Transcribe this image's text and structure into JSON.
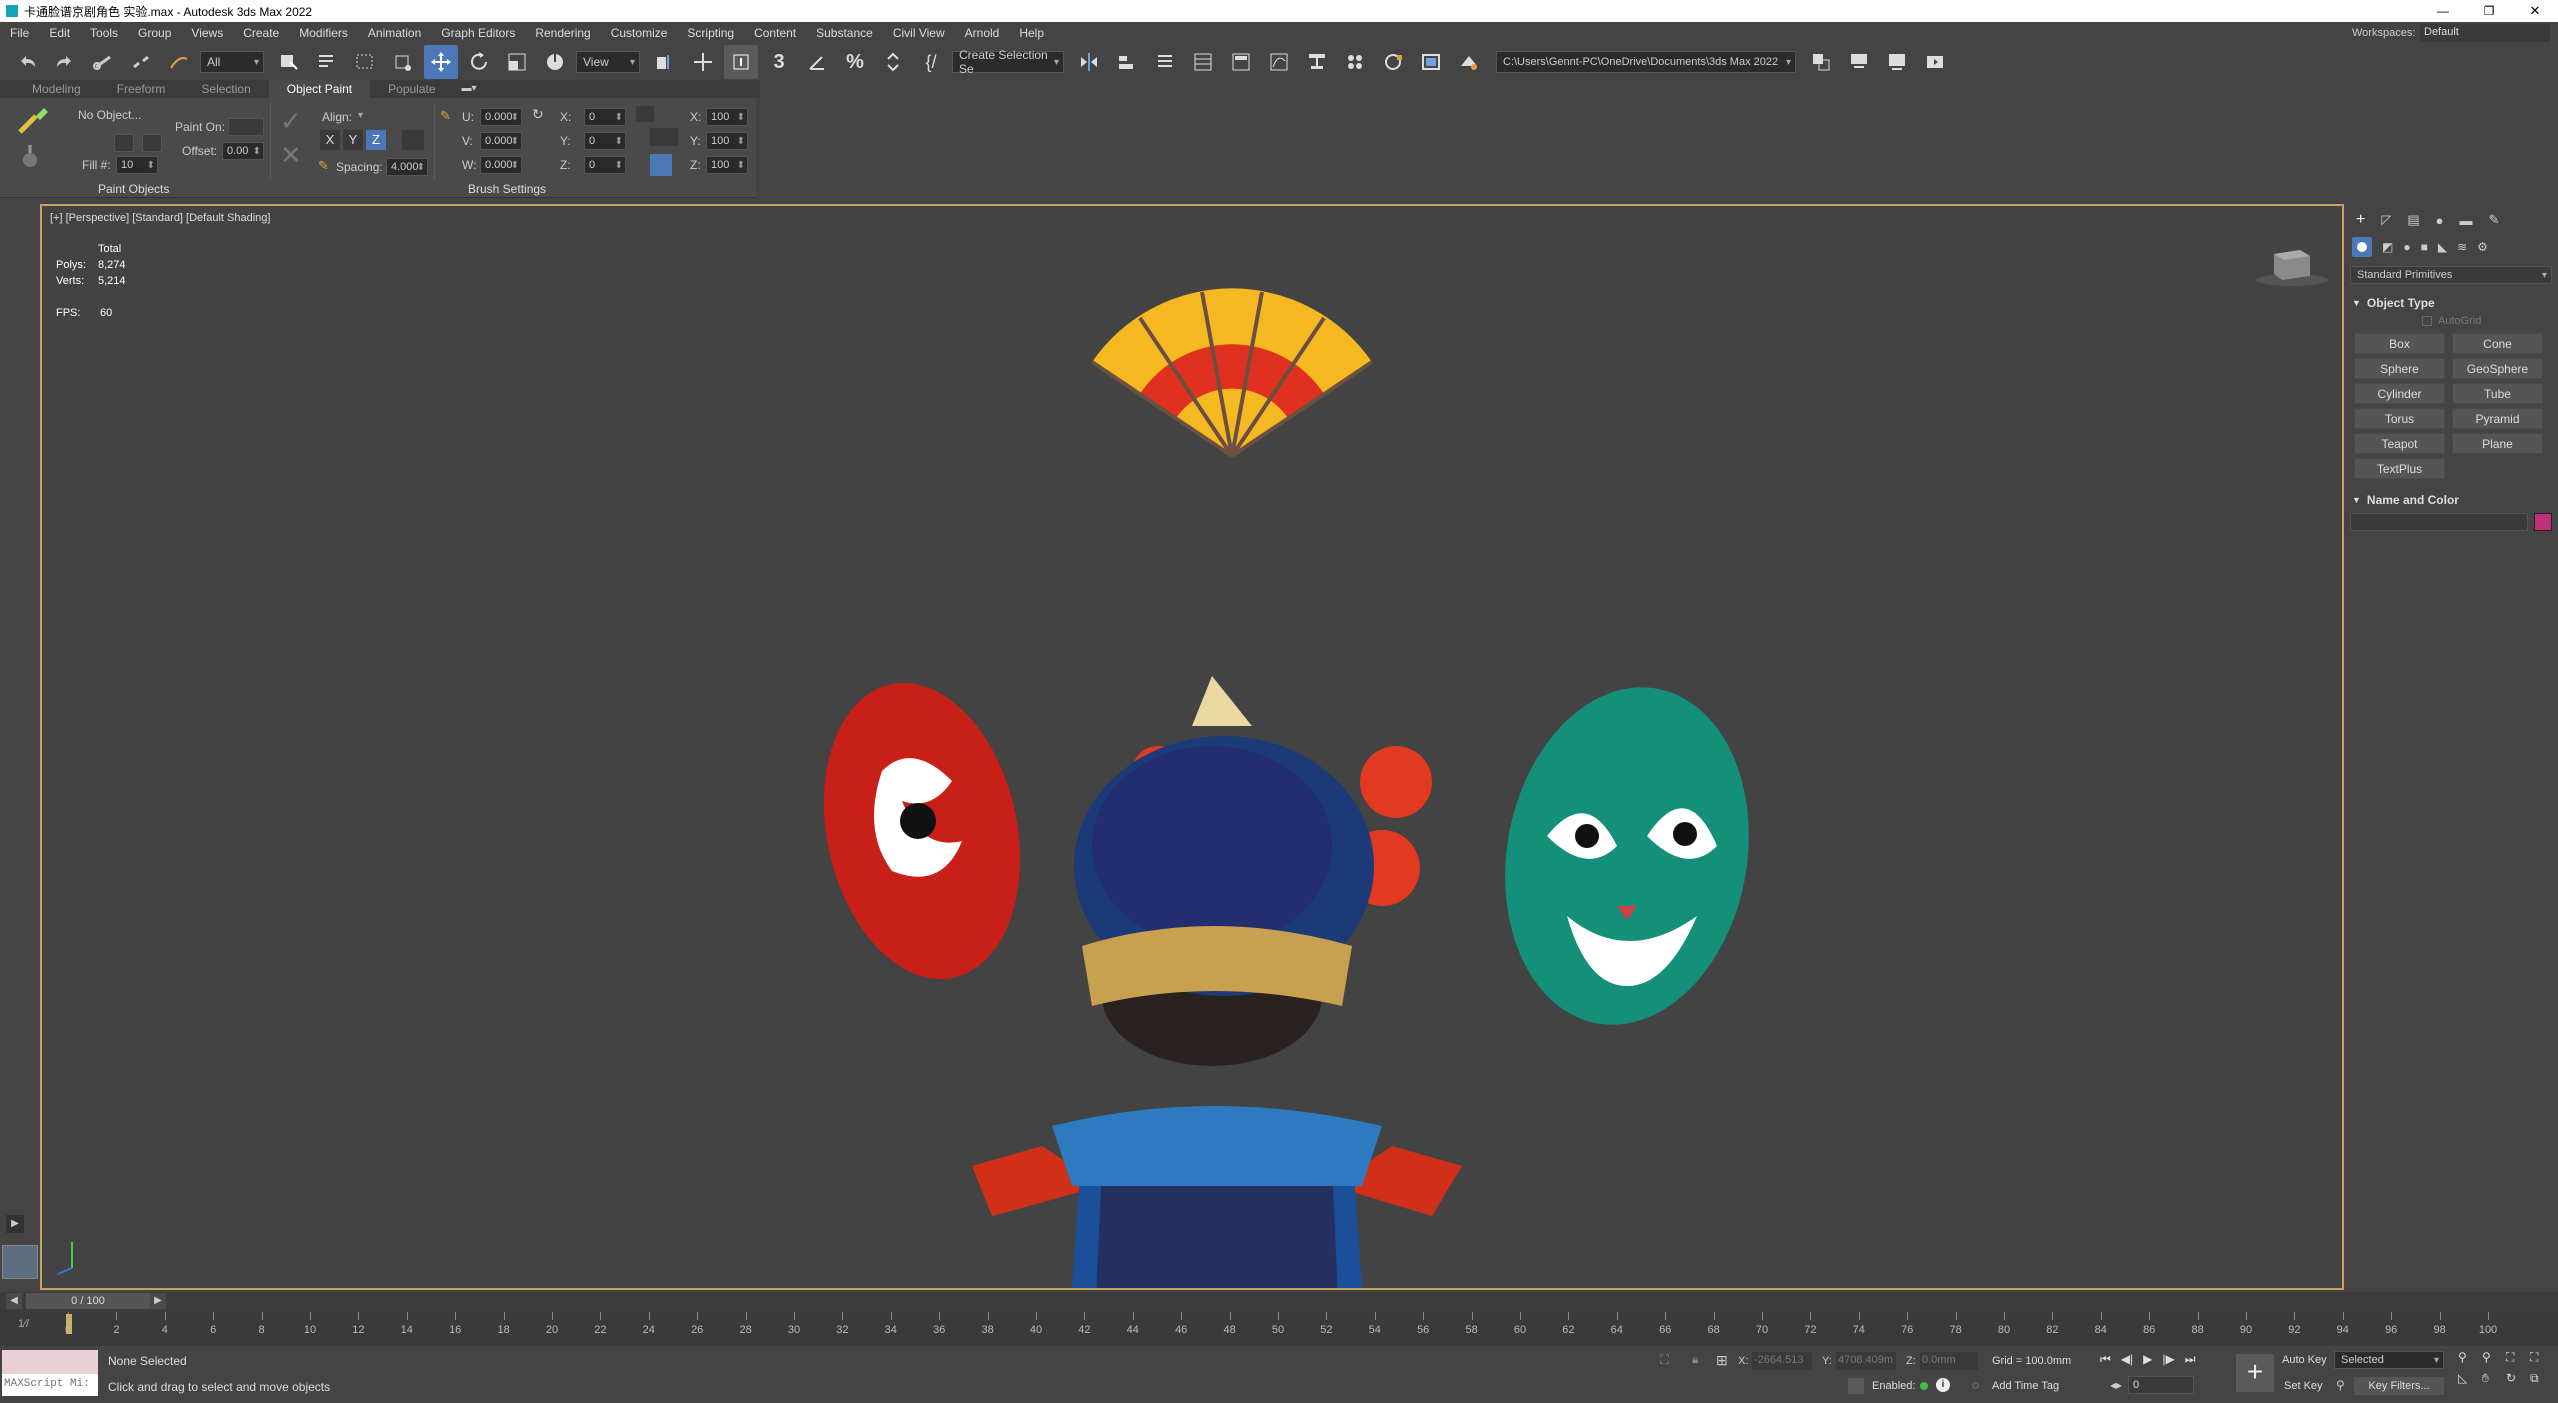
{
  "window": {
    "title": "卡通脸谱京剧角色 实验.max - Autodesk 3ds Max 2022",
    "controls": [
      "—",
      "❐",
      "✕"
    ]
  },
  "menu": {
    "items": [
      "File",
      "Edit",
      "Tools",
      "Group",
      "Views",
      "Create",
      "Modifiers",
      "Animation",
      "Graph Editors",
      "Rendering",
      "Customize",
      "Scripting",
      "Content",
      "Substance",
      "Civil View",
      "Arnold",
      "Help"
    ],
    "workspaces_label": "Workspaces:",
    "workspace_value": "Default"
  },
  "toolbar": {
    "selection_filter": "All",
    "ref_coord": "View",
    "named_selection": "Create Selection Se",
    "snap_3": "3",
    "project_path": "C:\\Users\\Gennt-PC\\OneDrive\\Documents\\3ds Max 2022"
  },
  "ribbon": {
    "tabs": [
      "Modeling",
      "Freeform",
      "Selection",
      "Object Paint",
      "Populate"
    ],
    "active_tab": 3,
    "no_object": "No Object...",
    "paint_on_label": "Paint On:",
    "offset_label": "Offset:",
    "offset_value": "0.00",
    "fill_label": "Fill #:",
    "fill_value": "10",
    "align_label": "Align:",
    "axis_x": "X",
    "axis_y": "Y",
    "axis_z": "Z",
    "spacing_label": "Spacing:",
    "spacing_value": "4.000",
    "u_label": "U:",
    "u_value": "0.000",
    "v_label": "V:",
    "v_value": "0.000",
    "w_label": "W:",
    "w_value": "0.000",
    "rx_label": "X:",
    "rx_value": "0",
    "ry_label": "Y:",
    "ry_value": "0",
    "rz_label": "Z:",
    "rz_value": "0",
    "sx_label": "X:",
    "sx_value": "100",
    "sy_label": "Y:",
    "sy_value": "100",
    "sz_label": "Z:",
    "sz_value": "100",
    "paint_objects_label": "Paint Objects",
    "brush_settings_label": "Brush Settings"
  },
  "viewport": {
    "label": "[+] [Perspective] [Standard] [Default Shading]",
    "stats_total": "Total",
    "polys_label": "Polys:",
    "polys_value": "8,274",
    "verts_label": "Verts:",
    "verts_value": "5,214",
    "fps_label": "FPS:",
    "fps_value": "60"
  },
  "command_panel": {
    "dropdown": "Standard Primitives",
    "object_type_title": "Object Type",
    "autogrid": "AutoGrid",
    "buttons": [
      "Box",
      "Cone",
      "Sphere",
      "GeoSphere",
      "Cylinder",
      "Tube",
      "Torus",
      "Pyramid",
      "Teapot",
      "Plane",
      "TextPlus"
    ],
    "name_color_title": "Name and Color",
    "color_swatch": "#c0307a"
  },
  "timeline": {
    "frame_label": "0 / 100",
    "ticks": [
      "0",
      "2",
      "4",
      "6",
      "8",
      "10",
      "12",
      "14",
      "16",
      "18",
      "20",
      "22",
      "24",
      "26",
      "28",
      "30",
      "32",
      "34",
      "36",
      "38",
      "40",
      "42",
      "44",
      "46",
      "48",
      "50",
      "52",
      "54",
      "56",
      "58",
      "60",
      "62",
      "64",
      "66",
      "68",
      "70",
      "72",
      "74",
      "76",
      "78",
      "80",
      "82",
      "84",
      "86",
      "88",
      "90",
      "92",
      "94",
      "96",
      "98",
      "100"
    ]
  },
  "status": {
    "maxscript": "MAXScript Mi:",
    "none_selected": "None Selected",
    "prompt": "Click and drag to select and move objects",
    "x_label": "X:",
    "x_value": "-2664.513",
    "y_label": "Y:",
    "y_value": "4708.409m",
    "z_label": "Z:",
    "z_value": "0.0mm",
    "grid": "Grid = 100.0mm",
    "enabled_label": "Enabled:",
    "add_time_tag": "Add Time Tag",
    "auto_key": "Auto Key",
    "selected_value": "Selected",
    "set_key": "Set Key",
    "key_filters": "Key Filters...",
    "current_frame": "0"
  }
}
